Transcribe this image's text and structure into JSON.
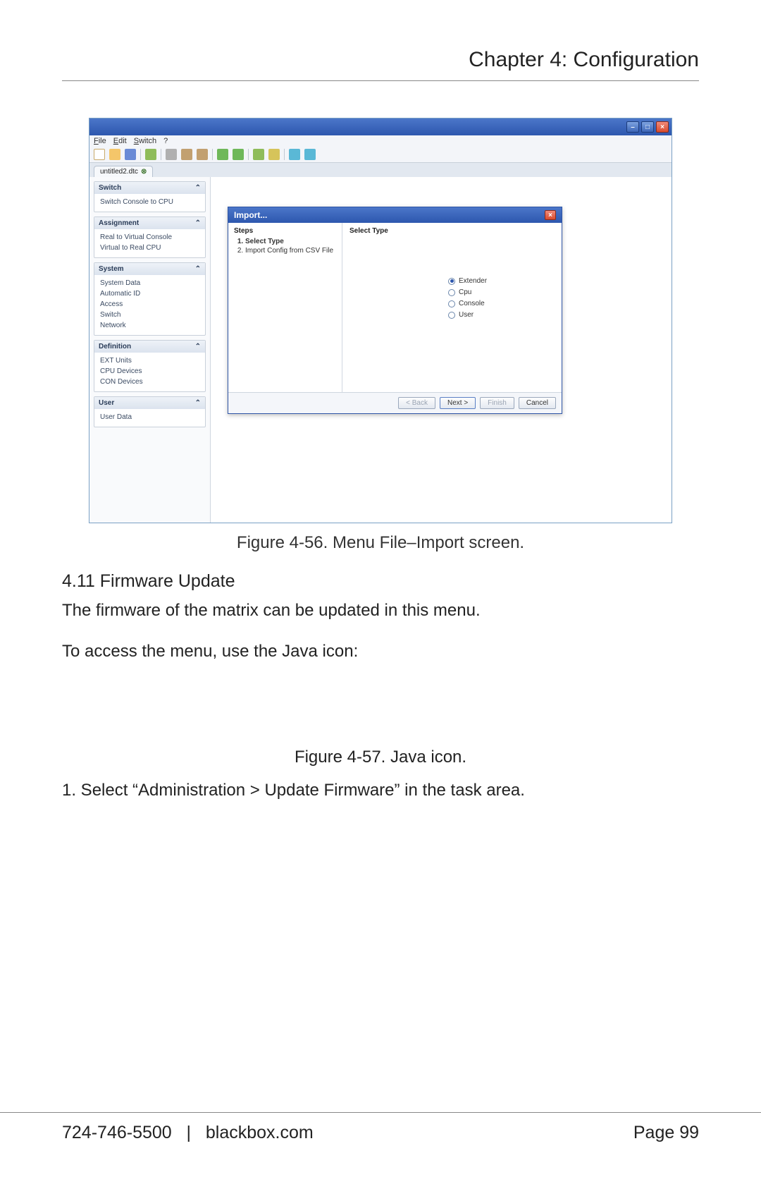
{
  "header": {
    "title": "Chapter 4: Configuration"
  },
  "figure1": {
    "caption": "Figure 4-56. Menu File–Import screen.",
    "window": {
      "menubar": [
        "File",
        "Edit",
        "Switch",
        "?"
      ],
      "tab": "untitled2.dtc",
      "sidebar": [
        {
          "title": "Switch",
          "items": [
            "Switch Console to CPU"
          ]
        },
        {
          "title": "Assignment",
          "items": [
            "Real to Virtual Console",
            "Virtual to Real CPU"
          ]
        },
        {
          "title": "System",
          "items": [
            "System Data",
            "Automatic ID",
            "Access",
            "Switch",
            "Network"
          ]
        },
        {
          "title": "Definition",
          "items": [
            "EXT Units",
            "CPU Devices",
            "CON Devices"
          ]
        },
        {
          "title": "User",
          "items": [
            "User Data"
          ]
        }
      ],
      "dialog": {
        "title": "Import...",
        "steps_header": "Steps",
        "steps": [
          "Select Type",
          "Import Config from CSV File"
        ],
        "right_header": "Select Type",
        "radios": [
          {
            "label": "Extender",
            "selected": true
          },
          {
            "label": "Cpu",
            "selected": false
          },
          {
            "label": "Console",
            "selected": false
          },
          {
            "label": "User",
            "selected": false
          }
        ],
        "buttons": {
          "back": "< Back",
          "next": "Next >",
          "finish": "Finish",
          "cancel": "Cancel"
        }
      }
    }
  },
  "section": {
    "title": "4.11 Firmware Update",
    "p1": "The firmware of the matrix can be updated in this menu.",
    "p2": "To access the menu, use the Java icon:"
  },
  "figure2": {
    "caption": "Figure 4-57. Java icon."
  },
  "step1": "1. Select “Administration > Update Firmware” in the task area.",
  "footer": {
    "phone": "724-746-5500",
    "site": "blackbox.com",
    "page": "Page 99"
  }
}
